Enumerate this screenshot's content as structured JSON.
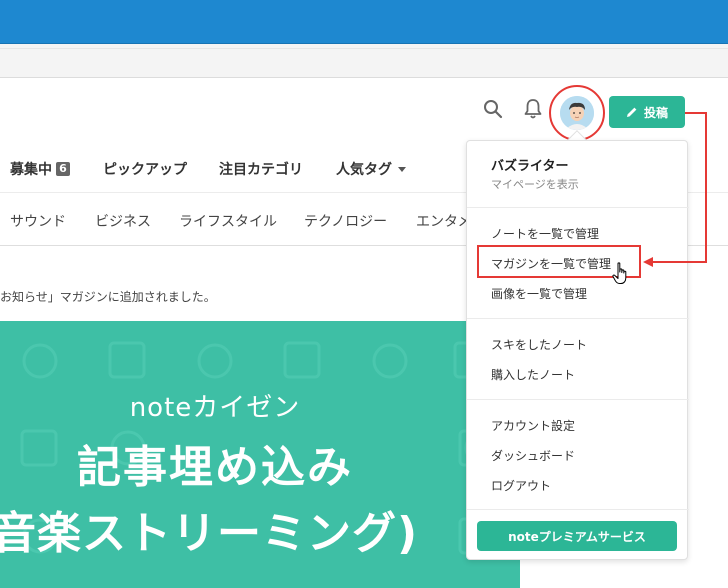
{
  "header": {
    "post_label": "投稿"
  },
  "nav_primary": {
    "items": [
      {
        "label": "募集中",
        "badge": "6"
      },
      {
        "label": "ピックアップ"
      },
      {
        "label": "注目カテゴリ"
      },
      {
        "label": "人気タグ"
      }
    ]
  },
  "nav_categories": {
    "items": [
      "サウンド",
      "ビジネス",
      "ライフスタイル",
      "テクノロジー",
      "エンタメ"
    ]
  },
  "notice": {
    "text": "お知らせ」マガジンに追加されました。"
  },
  "banner": {
    "subtitle": "noteカイゼン",
    "title_line1": "記事埋め込み",
    "title_line2": "音楽ストリーミング)"
  },
  "menu": {
    "user_name": "バズライター",
    "user_link": "マイページを表示",
    "group1": [
      "ノートを一覧で管理",
      "マガジンを一覧で管理",
      "画像を一覧で管理"
    ],
    "group2": [
      "スキをしたノート",
      "購入したノート"
    ],
    "group3": [
      "アカウント設定",
      "ダッシュボード",
      "ログアウト"
    ],
    "premium_label": "noteプレミアムサービス"
  },
  "colors": {
    "accent": "#2cb696",
    "highlight": "#e53935",
    "browser_bar": "#1e88d0"
  }
}
